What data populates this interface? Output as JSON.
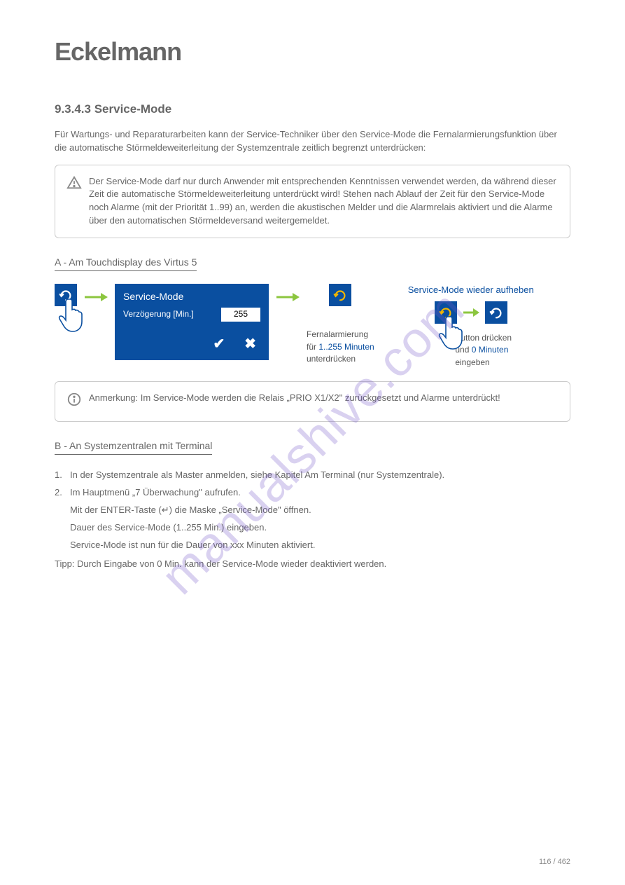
{
  "logo": "Eckelmann",
  "h_servicemode": "9.3.4.3 Service-Mode",
  "intro": "Für Wartungs- und Reparaturarbeiten kann der Service-Techniker über den Service-Mode die Fernalarmierungsfunktion über die automatische Störmeldeweiterleitung der Systemzentrale zeitlich begrenzt unterdrücken:",
  "boxA_text": "Der Service-Mode darf nur durch Anwender mit entsprechenden Kenntnissen verwendet werden, da während dieser Zeit die automatische Störmeldeweiterleitung unterdrückt wird! Stehen nach Ablauf der Zeit für den Service-Mode noch Alarme (mit der Priorität 1..99) an, werden die akustischen Melder und die Alarmrelais aktiviert und die Alarme über den automatischen Störmeldeversand weitergemeldet.",
  "h_A": "A - Am Touchdisplay des Virtus 5",
  "panel_title": "Service-Mode",
  "panel_label": "Verzögerung [Min.]",
  "panel_value": "255",
  "cap_mid_1": "Fernalarmierung",
  "cap_mid_2a": "für ",
  "cap_mid_2b": "1..255 Minuten",
  "cap_mid_3": "unterdrücken",
  "right_headline": "Service-Mode wieder aufheben",
  "cap_r_1": "Button drücken",
  "cap_r_2a": "und ",
  "cap_r_2b": "0 Minuten",
  "cap_r_3": "eingeben",
  "boxB_text": "Anmerkung: Im Service-Mode werden die Relais „PRIO X1/X2\" zurückgesetzt und Alarme unterdrückt!",
  "h_B": "B - An Systemzentralen mit Terminal",
  "step1": "In der Systemzentrale als Master anmelden, siehe Kapitel Am Terminal (nur Systemzentrale).",
  "step2a": "Im Hauptmenü „7 Überwachung\" aufrufen.",
  "step2b": "Mit der ENTER-Taste (↵) die Maske „Service-Mode\" öffnen.",
  "step2c": "Dauer des Service-Mode (1..255 Min.) eingeben.",
  "step2d": "Service-Mode ist nun für die Dauer von xxx Minuten aktiviert.",
  "tipp": "Tipp: Durch Eingabe von 0 Min. kann der Service-Mode wieder deaktiviert werden.",
  "watermark": "manualshive.com",
  "footer": "116 / 462"
}
